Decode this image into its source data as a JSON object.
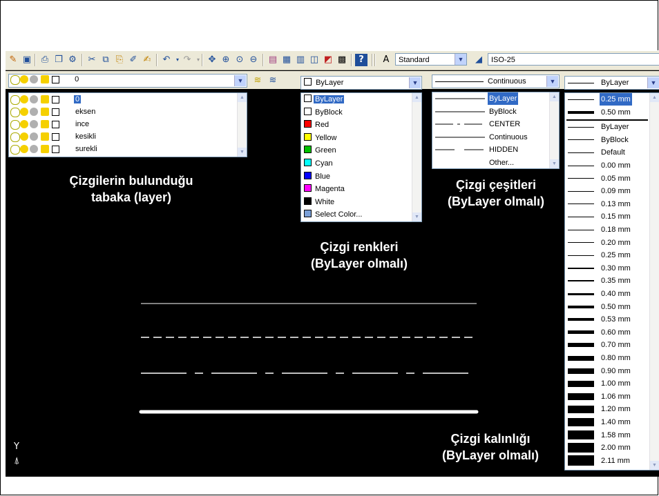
{
  "toolbar": {
    "text_style": "Standard",
    "dim_style": "ISO-25"
  },
  "layer": {
    "current": "0",
    "items": [
      {
        "name": "0",
        "selected": true
      },
      {
        "name": "eksen",
        "selected": false
      },
      {
        "name": "ince",
        "selected": false
      },
      {
        "name": "kesikli",
        "selected": false
      },
      {
        "name": "surekli",
        "selected": false
      }
    ]
  },
  "color": {
    "current": "ByLayer",
    "items": [
      {
        "label": "ByLayer",
        "color": "#ffffff",
        "selected": true
      },
      {
        "label": "ByBlock",
        "color": "#ffffff",
        "selected": false
      },
      {
        "label": "Red",
        "color": "#ff0000",
        "selected": false
      },
      {
        "label": "Yellow",
        "color": "#ffff00",
        "selected": false
      },
      {
        "label": "Green",
        "color": "#00c000",
        "selected": false
      },
      {
        "label": "Cyan",
        "color": "#00ffff",
        "selected": false
      },
      {
        "label": "Blue",
        "color": "#0000ff",
        "selected": false
      },
      {
        "label": "Magenta",
        "color": "#ff00ff",
        "selected": false
      },
      {
        "label": "White",
        "color": "#000000",
        "selected": false
      },
      {
        "label": "Select Color...",
        "color": "#7aa0d8",
        "selected": false
      }
    ]
  },
  "linetype": {
    "current": "Continuous",
    "items": [
      {
        "label": "ByLayer",
        "style": "solid",
        "selected": true
      },
      {
        "label": "ByBlock",
        "style": "solid",
        "selected": false
      },
      {
        "label": "CENTER",
        "style": "center",
        "selected": false
      },
      {
        "label": "Continuous",
        "style": "solid",
        "selected": false
      },
      {
        "label": "HIDDEN",
        "style": "hidden",
        "selected": false
      },
      {
        "label": "Other...",
        "style": "none",
        "selected": false
      }
    ]
  },
  "lineweight": {
    "current": "ByLayer",
    "top_items": [
      {
        "label": "0.25 mm",
        "weight": 1,
        "selected": true
      },
      {
        "label": "0.50 mm",
        "weight": 4,
        "selected": false
      }
    ],
    "items": [
      {
        "label": "ByLayer",
        "weight": 1
      },
      {
        "label": "ByBlock",
        "weight": 1
      },
      {
        "label": "Default",
        "weight": 1
      },
      {
        "label": "0.00 mm",
        "weight": 1
      },
      {
        "label": "0.05 mm",
        "weight": 1
      },
      {
        "label": "0.09 mm",
        "weight": 1
      },
      {
        "label": "0.13 mm",
        "weight": 1
      },
      {
        "label": "0.15 mm",
        "weight": 1
      },
      {
        "label": "0.18 mm",
        "weight": 1
      },
      {
        "label": "0.20 mm",
        "weight": 1
      },
      {
        "label": "0.25 mm",
        "weight": 1
      },
      {
        "label": "0.30 mm",
        "weight": 2
      },
      {
        "label": "0.35 mm",
        "weight": 2
      },
      {
        "label": "0.40 mm",
        "weight": 3
      },
      {
        "label": "0.50 mm",
        "weight": 4
      },
      {
        "label": "0.53 mm",
        "weight": 4
      },
      {
        "label": "0.60 mm",
        "weight": 5
      },
      {
        "label": "0.70 mm",
        "weight": 6
      },
      {
        "label": "0.80 mm",
        "weight": 7
      },
      {
        "label": "0.90 mm",
        "weight": 8
      },
      {
        "label": "1.00 mm",
        "weight": 9
      },
      {
        "label": "1.06 mm",
        "weight": 10
      },
      {
        "label": "1.20 mm",
        "weight": 11
      },
      {
        "label": "1.40 mm",
        "weight": 12
      },
      {
        "label": "1.58 mm",
        "weight": 13
      },
      {
        "label": "2.00 mm",
        "weight": 14
      },
      {
        "label": "2.11 mm",
        "weight": 15
      }
    ]
  },
  "captions": {
    "layer_line1": "Çizgilerin bulunduğu",
    "layer_line2": "tabaka (layer)",
    "color_line1": "Çizgi renkleri",
    "color_line2": "(ByLayer olmalı)",
    "linetype_line1": "Çizgi çeşitleri",
    "linetype_line2": "(ByLayer olmalı)",
    "lineweight_line1": "Çizgi kalınlığı",
    "lineweight_line2": "(ByLayer olmalı)"
  },
  "ucs": {
    "y_label": "Y"
  }
}
